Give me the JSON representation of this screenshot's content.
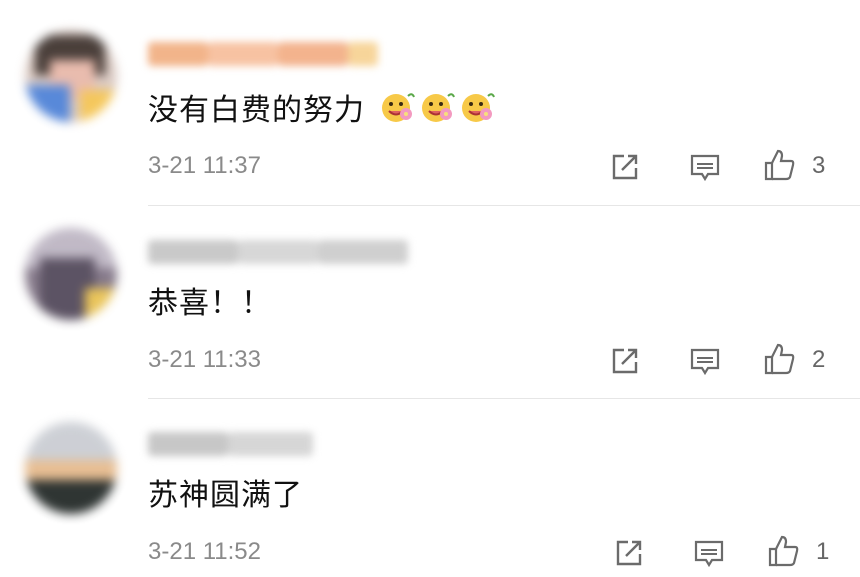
{
  "comments": [
    {
      "text": "没有白费的努力",
      "emoji_count": 3,
      "time": "3-21 11:37",
      "likes": "3",
      "icons": [
        "repost-icon",
        "comment-icon",
        "like-icon"
      ]
    },
    {
      "text": "恭喜！！",
      "time": "3-21 11:33",
      "likes": "2",
      "icons": [
        "repost-icon",
        "comment-icon",
        "like-icon"
      ]
    },
    {
      "text": "苏神圆满了",
      "time": "3-21 11:52",
      "likes": "1",
      "icons": [
        "repost-icon",
        "comment-icon",
        "like-icon"
      ]
    }
  ],
  "colors": {
    "text": "#111111",
    "meta": "#8a8a8a",
    "icon": "#6b6b6b",
    "divider": "#e6e6e6"
  }
}
